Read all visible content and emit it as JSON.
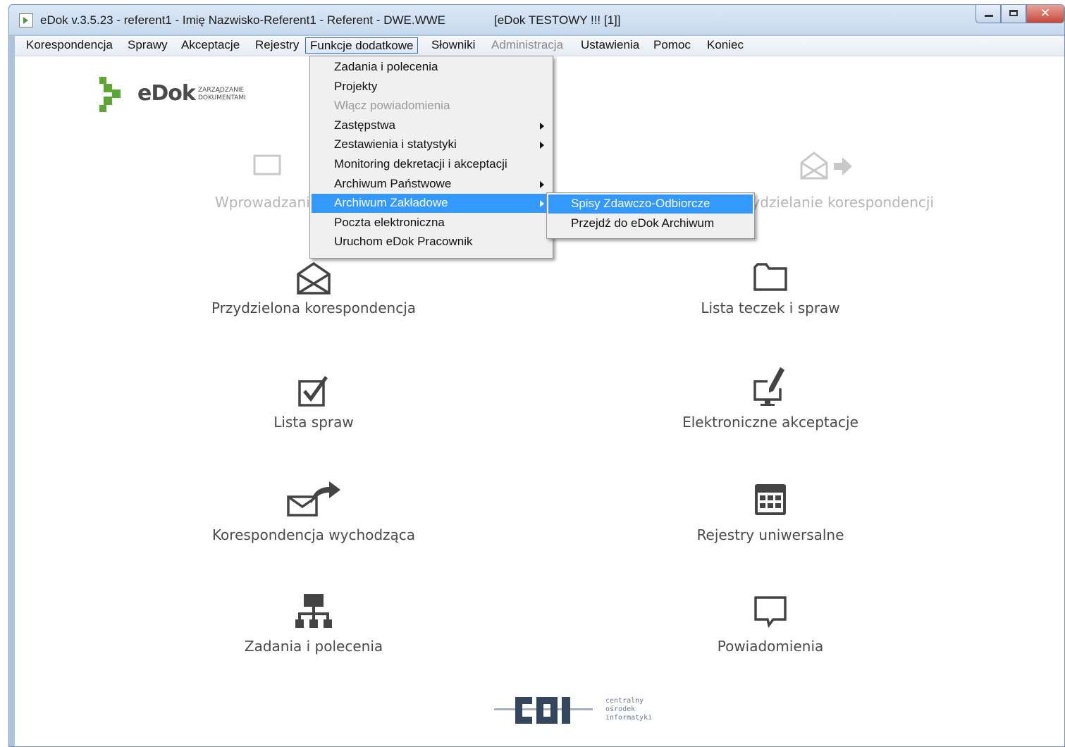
{
  "window": {
    "title": "eDok v.3.5.23 - referent1 - Imię Nazwisko-Referent1 - Referent - DWE.WWE",
    "environment": "[eDok TESTOWY !!! [1]]",
    "close_glyph": "✕"
  },
  "menubar": {
    "items": [
      {
        "label": "Korespondencja"
      },
      {
        "label": "Sprawy"
      },
      {
        "label": "Akceptacje"
      },
      {
        "label": "Rejestry"
      },
      {
        "label": "Funkcje dodatkowe",
        "state": "open"
      },
      {
        "label": "Słowniki"
      },
      {
        "label": "Administracja",
        "state": "disabled"
      },
      {
        "label": "Ustawienia"
      },
      {
        "label": "Pomoc"
      },
      {
        "label": "Koniec"
      }
    ]
  },
  "dropdown": {
    "items": [
      {
        "label": "Zadania i polecenia"
      },
      {
        "label": "Projekty"
      },
      {
        "label": "Włącz powiadomienia",
        "disabled": true
      },
      {
        "label": "Zastępstwa",
        "submenu": true
      },
      {
        "label": "Zestawienia i statystyki",
        "submenu": true
      },
      {
        "label": "Monitoring dekretacji i akceptacji"
      },
      {
        "label": "Archiwum Państwowe",
        "submenu": true
      },
      {
        "label": "Archiwum Zakładowe",
        "submenu": true,
        "highlighted": true
      },
      {
        "label": "Poczta elektroniczna"
      },
      {
        "label": "Uruchom eDok Pracownik"
      }
    ]
  },
  "submenu": {
    "items": [
      {
        "label": "Spisy Zdawczo-Odbiorcze",
        "highlighted": true
      },
      {
        "label": "Przejdź do eDok Archiwum"
      }
    ]
  },
  "logo": {
    "name": "eDok",
    "subtitle_line1": "ZARZĄDZANIE",
    "subtitle_line2": "DOKUMENTAMI"
  },
  "tiles": {
    "wprowadzanie": {
      "label": "Wprowadzani",
      "icon": "envelope-icon",
      "faded": true
    },
    "przydzielanie": {
      "label": "ydzielanie korespondencji",
      "icon": "envelope-forward-icon",
      "faded": true
    },
    "przydzielona": {
      "label": "Przydzielona korespondencja",
      "icon": "open-envelope-icon"
    },
    "teczki": {
      "label": "Lista teczek i spraw",
      "icon": "folder-icon"
    },
    "sprawy": {
      "label": "Lista spraw",
      "icon": "checkbox-icon"
    },
    "akceptacje": {
      "label": "Elektroniczne akceptacje",
      "icon": "monitor-pen-icon"
    },
    "wychodzaca": {
      "label": "Korespondencja wychodząca",
      "icon": "envelope-send-icon"
    },
    "rejestry": {
      "label": "Rejestry uniwersalne",
      "icon": "calendar-grid-icon"
    },
    "zadania": {
      "label": "Zadania i polecenia",
      "icon": "org-chart-icon"
    },
    "powiadomienia": {
      "label": "Powiadomienia",
      "icon": "speech-bubble-icon"
    }
  },
  "footer_logo": {
    "name": "COI",
    "line1": "centralny",
    "line2": "ośrodek",
    "line3": "informatyki"
  },
  "colors": {
    "menu_highlight": "#3399ff",
    "icon": "#444444",
    "label": "#4a4a4a",
    "brand_green": "#5aa832"
  }
}
